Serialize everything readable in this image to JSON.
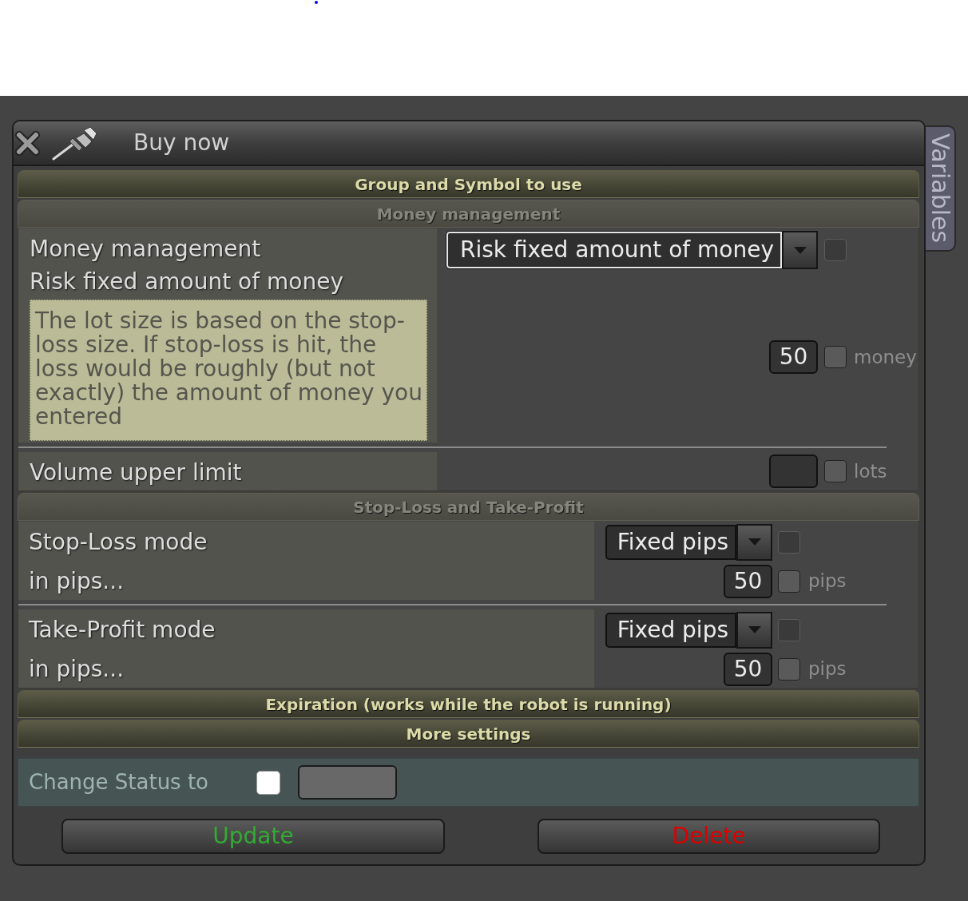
{
  "window": {
    "title": "Buy now"
  },
  "side_tab": {
    "label": "Variables"
  },
  "sections": [
    {
      "title": "Group and Symbol to use",
      "expanded": false
    },
    {
      "title": "Money management",
      "expanded": true,
      "rows": [
        {
          "kind": "stacked",
          "labels": [
            "Money management",
            "Risk fixed amount of money"
          ],
          "description": "The lot size is based on the stop-loss size. If stop-loss is hit, the loss would be roughly (but not exactly) the amount of money you entered",
          "controls": [
            {
              "kind": "select",
              "value": "Risk fixed amount of money",
              "focused": true,
              "checkbox": {
                "checked": false,
                "disabled": true
              }
            },
            {
              "kind": "number",
              "value": "50",
              "unit": "money",
              "checkbox": {
                "checked": false,
                "disabled": false
              }
            }
          ]
        },
        {
          "kind": "stacked",
          "labels": [
            "Volume upper limit"
          ],
          "controls": [
            {
              "kind": "number",
              "unit": "lots",
              "checkbox": {
                "checked": false,
                "disabled": false
              }
            }
          ]
        }
      ]
    },
    {
      "title": "Stop-Loss and Take-Profit",
      "expanded": true,
      "rows": [
        {
          "kind": "paired",
          "labels": [
            "Stop-Loss mode",
            "in pips..."
          ],
          "controls": [
            {
              "kind": "select",
              "value": "Fixed pips",
              "focused": false,
              "checkbox": {
                "checked": false,
                "disabled": true
              }
            },
            {
              "kind": "number",
              "value": "50",
              "unit": "pips",
              "checkbox": {
                "checked": false,
                "disabled": false
              }
            }
          ]
        },
        {
          "kind": "paired",
          "labels": [
            "Take-Profit mode",
            "in pips..."
          ],
          "controls": [
            {
              "kind": "select",
              "value": "Fixed pips",
              "focused": false,
              "checkbox": {
                "checked": false,
                "disabled": true
              }
            },
            {
              "kind": "number",
              "value": "50",
              "unit": "pips",
              "checkbox": {
                "checked": false,
                "disabled": false
              }
            }
          ]
        }
      ]
    },
    {
      "title": "Expiration (works while the robot is running)",
      "expanded": false
    },
    {
      "title": "More settings",
      "expanded": false
    }
  ],
  "status_row": {
    "label": "Change Status to",
    "checkbox": {
      "checked": false
    }
  },
  "buttons": [
    {
      "label": "Update",
      "color": "#33aa33"
    },
    {
      "label": "Delete",
      "color": "#dd0000"
    }
  ]
}
